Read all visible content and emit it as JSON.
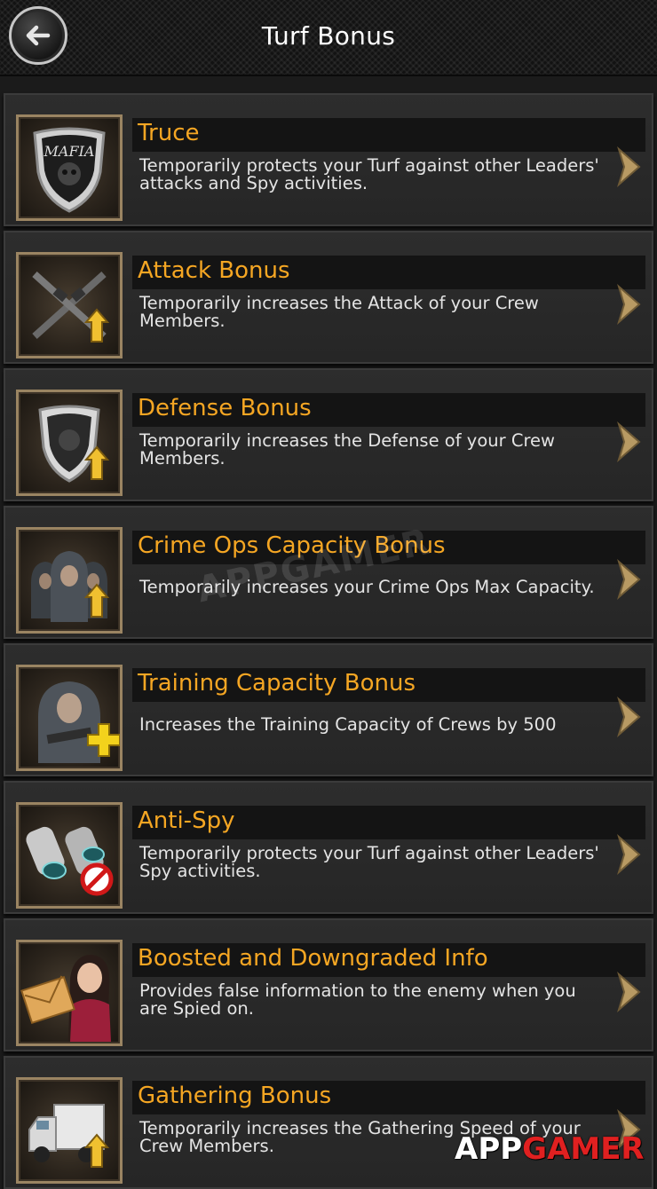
{
  "header": {
    "title": "Turf Bonus",
    "back_icon": "back-arrow-icon"
  },
  "items": [
    {
      "title": "Truce",
      "description": "Temporarily protects your Turf against other Leaders' attacks and Spy activities.",
      "icon": "mafia-shield-icon"
    },
    {
      "title": "Attack Bonus",
      "description": "Temporarily increases the Attack of your Crew Members.",
      "icon": "crossed-rifles-icon"
    },
    {
      "title": "Defense Bonus",
      "description": "Temporarily increases the Defense of your Crew Members.",
      "icon": "skull-shield-icon"
    },
    {
      "title": "Crime Ops Capacity Bonus",
      "description": "Temporarily increases your Crime Ops Max Capacity.",
      "icon": "hooded-crew-icon"
    },
    {
      "title": "Training Capacity Bonus",
      "description": "Increases the Training Capacity of Crews by 500",
      "icon": "hooded-figure-plus-icon"
    },
    {
      "title": "Anti-Spy",
      "description": "Temporarily protects your Turf against other Leaders' Spy activities.",
      "icon": "binoculars-prohibited-icon"
    },
    {
      "title": "Boosted and Downgraded Info",
      "description": "Provides false information to the enemy when you are Spied on.",
      "icon": "envelope-woman-icon"
    },
    {
      "title": "Gathering Bonus",
      "description": "Temporarily increases the Gathering Speed of your Crew Members.",
      "icon": "truck-icon"
    }
  ],
  "watermark": {
    "center": "APPGAMER",
    "footer_white": "APP",
    "footer_red": "GAMER"
  },
  "colors": {
    "accent": "#f5a623",
    "background": "#1b1b1b",
    "card": "#2a2a2a"
  }
}
